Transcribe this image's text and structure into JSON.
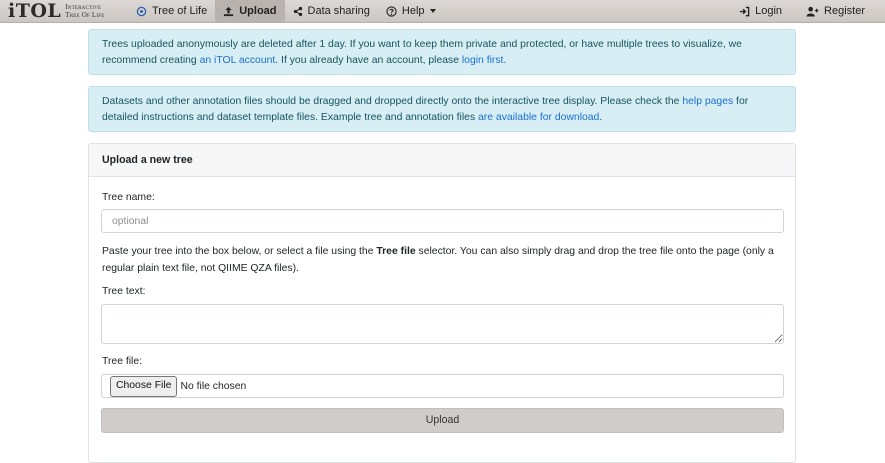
{
  "brand": {
    "logo": "iTOL",
    "line1": "Interactive",
    "line2": "Tree Of Life"
  },
  "nav": {
    "items": [
      {
        "label": "Tree of Life",
        "icon": "tree-icon"
      },
      {
        "label": "Upload",
        "icon": "upload-icon"
      },
      {
        "label": "Data sharing",
        "icon": "share-icon"
      },
      {
        "label": "Help",
        "icon": "question-icon"
      }
    ],
    "login": "Login",
    "register": "Register"
  },
  "alert1": {
    "t1": "Trees uploaded anonymously are deleted after 1 day. If you want to keep them private and protected, or have multiple trees to visualize, we recommend creating ",
    "link1": "an iTOL account",
    "t2": ". If you already have an account, please ",
    "link2": "login first",
    "t3": "."
  },
  "alert2": {
    "t1": "Datasets and other annotation files should be dragged and dropped directly onto the interactive tree display. Please check the ",
    "link1": "help pages",
    "t2": " for detailed instructions and dataset template files. Example tree and annotation files ",
    "link2": "are available for download",
    "t3": "."
  },
  "form": {
    "header": "Upload a new tree",
    "tree_name_label": "Tree name:",
    "tree_name_placeholder": "optional",
    "help_t1": "Paste your tree into the box below, or select a file using the ",
    "help_bold": "Tree file",
    "help_t2": " selector. You can also simply drag and drop the tree file onto the page (only a regular plain text file, not QIIME QZA files).",
    "tree_text_label": "Tree text:",
    "tree_file_label": "Tree file:",
    "choose_file": "Choose File",
    "no_file": "No file chosen",
    "upload_button": "Upload"
  }
}
